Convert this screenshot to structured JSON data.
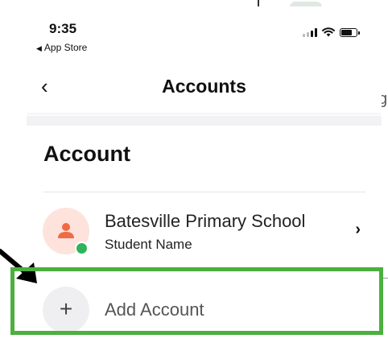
{
  "status_bar": {
    "time": "9:35",
    "back_to_app": "App Store",
    "back_triangle": "◀"
  },
  "nav": {
    "back_glyph": "‹",
    "title": "Accounts"
  },
  "section": {
    "title": "Account"
  },
  "account": {
    "name": "Batesville Primary School",
    "subtitle": "Student Name",
    "chevron": "›",
    "status_color": "#2fb35c",
    "avatar_color": "#f26a45"
  },
  "add_account": {
    "icon_glyph": "+",
    "label": "Add Account"
  },
  "annotation": {
    "highlight_color": "#4caf3f",
    "arrow_color": "#000000"
  },
  "background": {
    "partial_glyph_top": "t",
    "partial_glyph_mid": "g"
  }
}
